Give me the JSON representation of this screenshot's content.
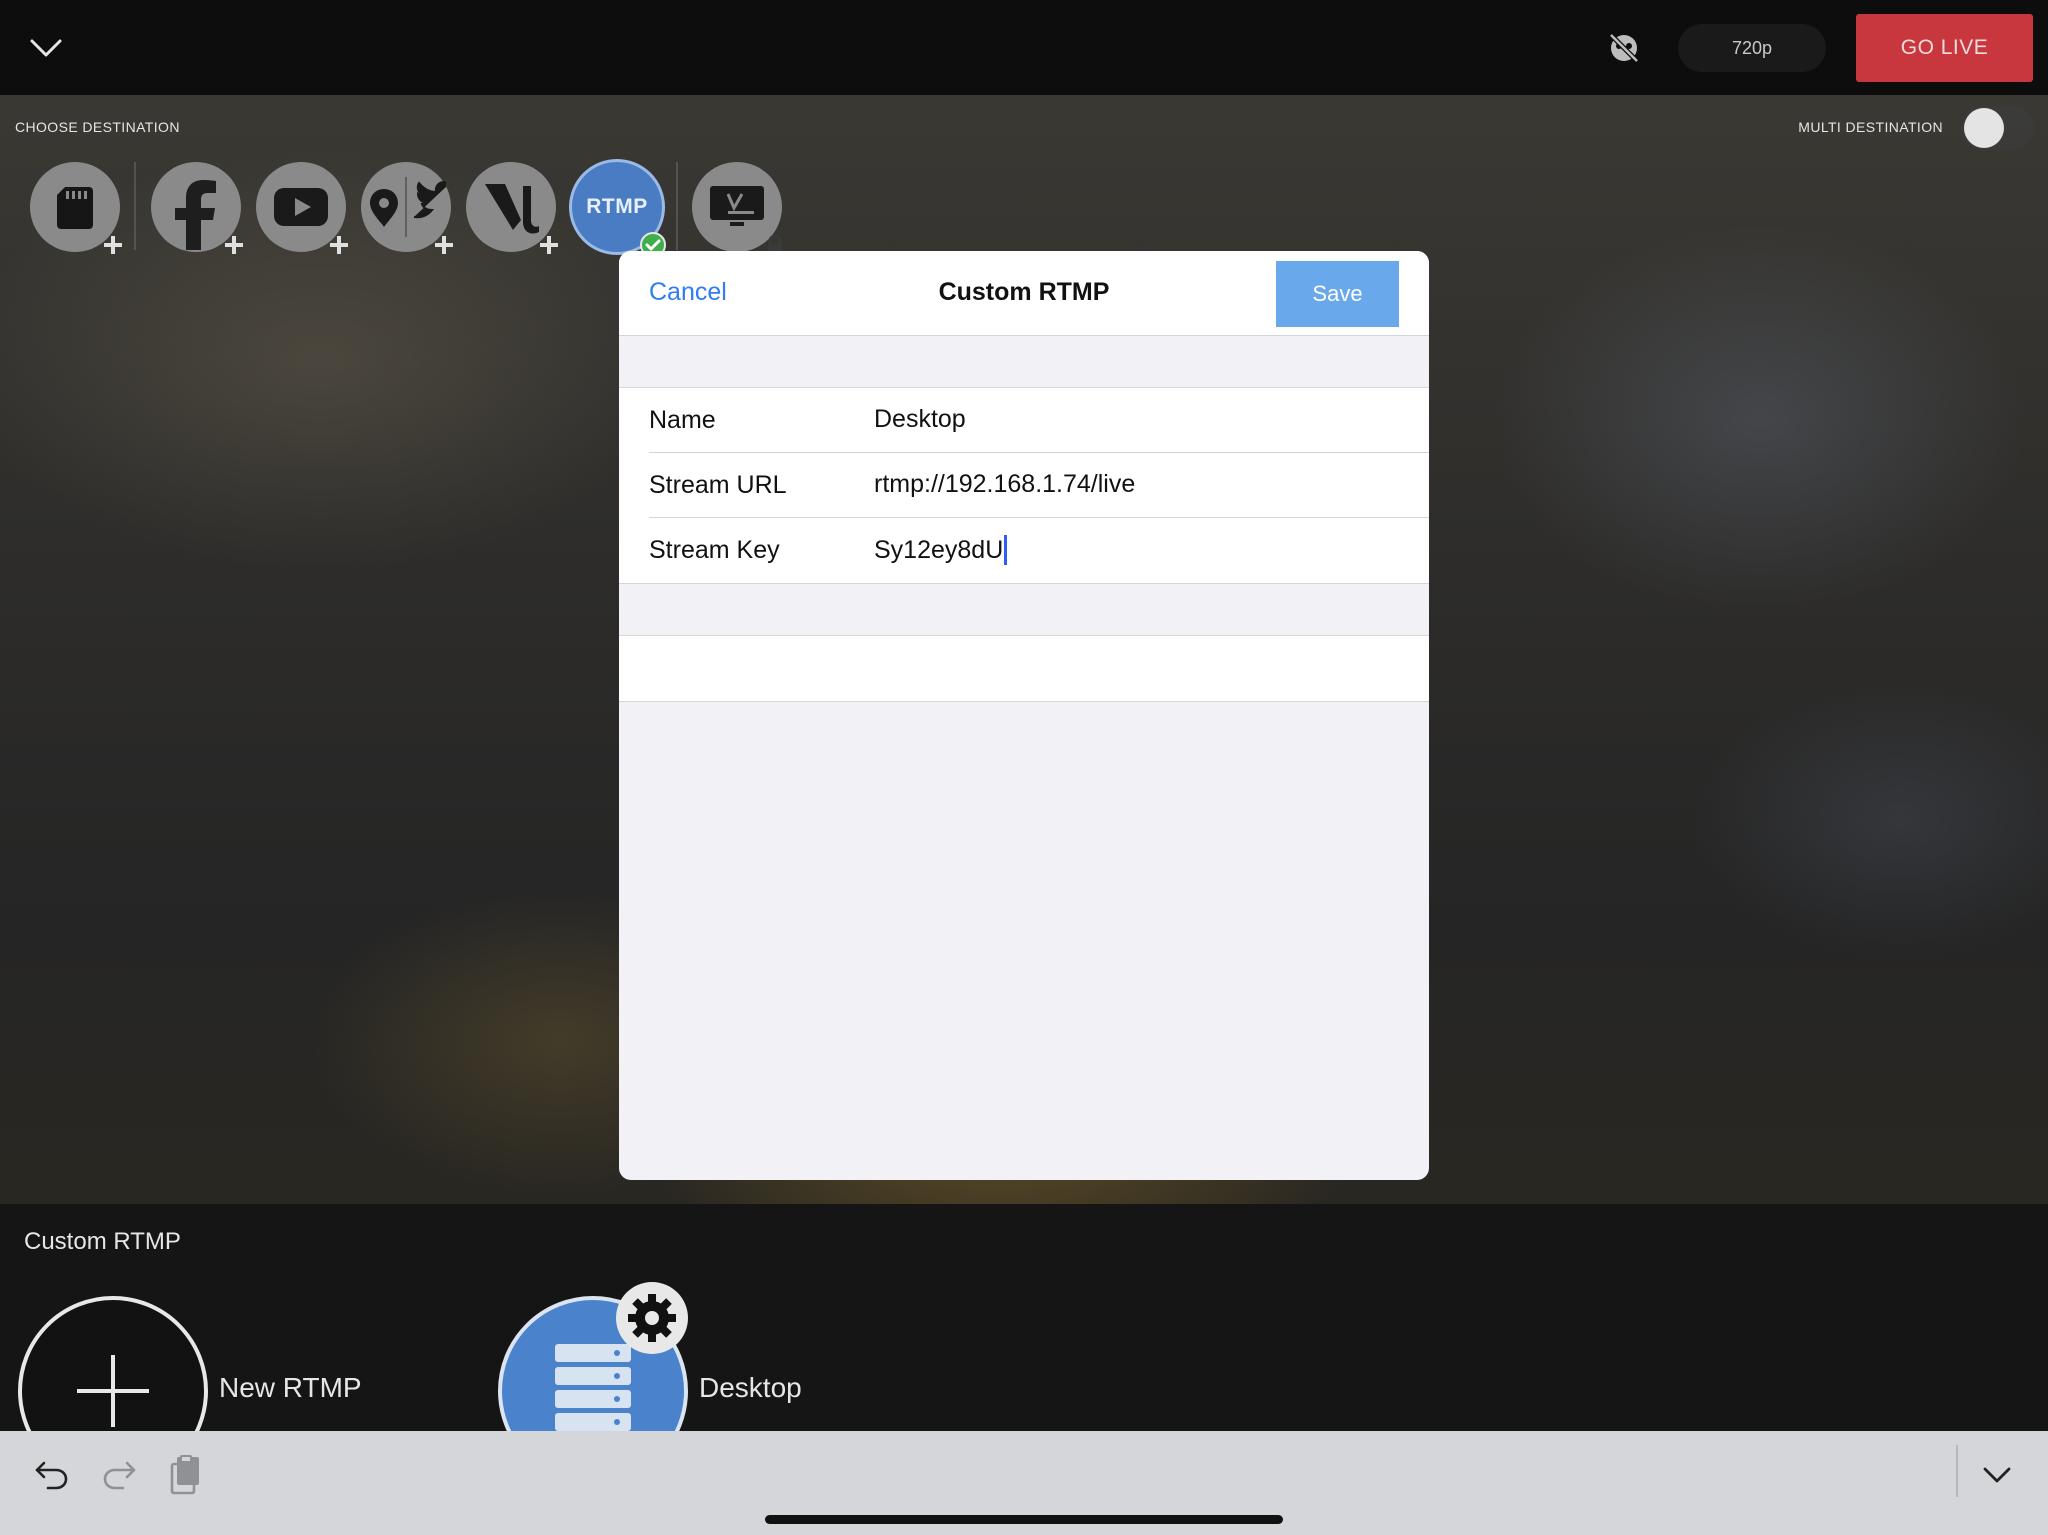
{
  "topbar": {
    "collapse_icon": "chevron-down-icon",
    "privacy_icon": "eye-slash-icon",
    "resolution": "720p",
    "go_live_label": "GO LIVE"
  },
  "destinations": {
    "choose_label": "CHOOSE DESTINATION",
    "multi_label": "MULTI DESTINATION",
    "multi_enabled": false,
    "items": [
      {
        "name": "sd-card",
        "icon": "sd-card-icon",
        "badge": "plus"
      },
      {
        "name": "facebook",
        "icon": "facebook-icon",
        "badge": "plus"
      },
      {
        "name": "youtube",
        "icon": "youtube-icon",
        "badge": "plus"
      },
      {
        "name": "periscope-twitter",
        "icon": "periscope-twitter-icon",
        "badge": "plus"
      },
      {
        "name": "restream",
        "icon": "restream-icon",
        "badge": "plus"
      },
      {
        "name": "rtmp",
        "label": "RTMP",
        "badge": "check",
        "selected": true
      },
      {
        "name": "vimeo",
        "icon": "vimeo-icon",
        "badge": "lock"
      }
    ]
  },
  "modal": {
    "cancel_label": "Cancel",
    "title": "Custom RTMP",
    "save_label": "Save",
    "fields": [
      {
        "label": "Name",
        "value": "Desktop"
      },
      {
        "label": "Stream URL",
        "value": "rtmp://192.168.1.74/live"
      },
      {
        "label": "Stream Key",
        "value": "Sy12ey8dU"
      }
    ]
  },
  "bottom": {
    "section_title": "Custom RTMP",
    "new_label": "New RTMP",
    "saved_label": "Desktop"
  },
  "accessory": {
    "undo_icon": "undo-icon",
    "redo_icon": "redo-icon",
    "paste_icon": "clipboard-icon",
    "dismiss_icon": "chevron-down-icon"
  },
  "colors": {
    "go_live": "#c8373d",
    "rtmp_blue": "#4a7cc4",
    "link_blue": "#2f7cf6",
    "save_button": "#6aa8ec",
    "check_green": "#3fae4b"
  }
}
